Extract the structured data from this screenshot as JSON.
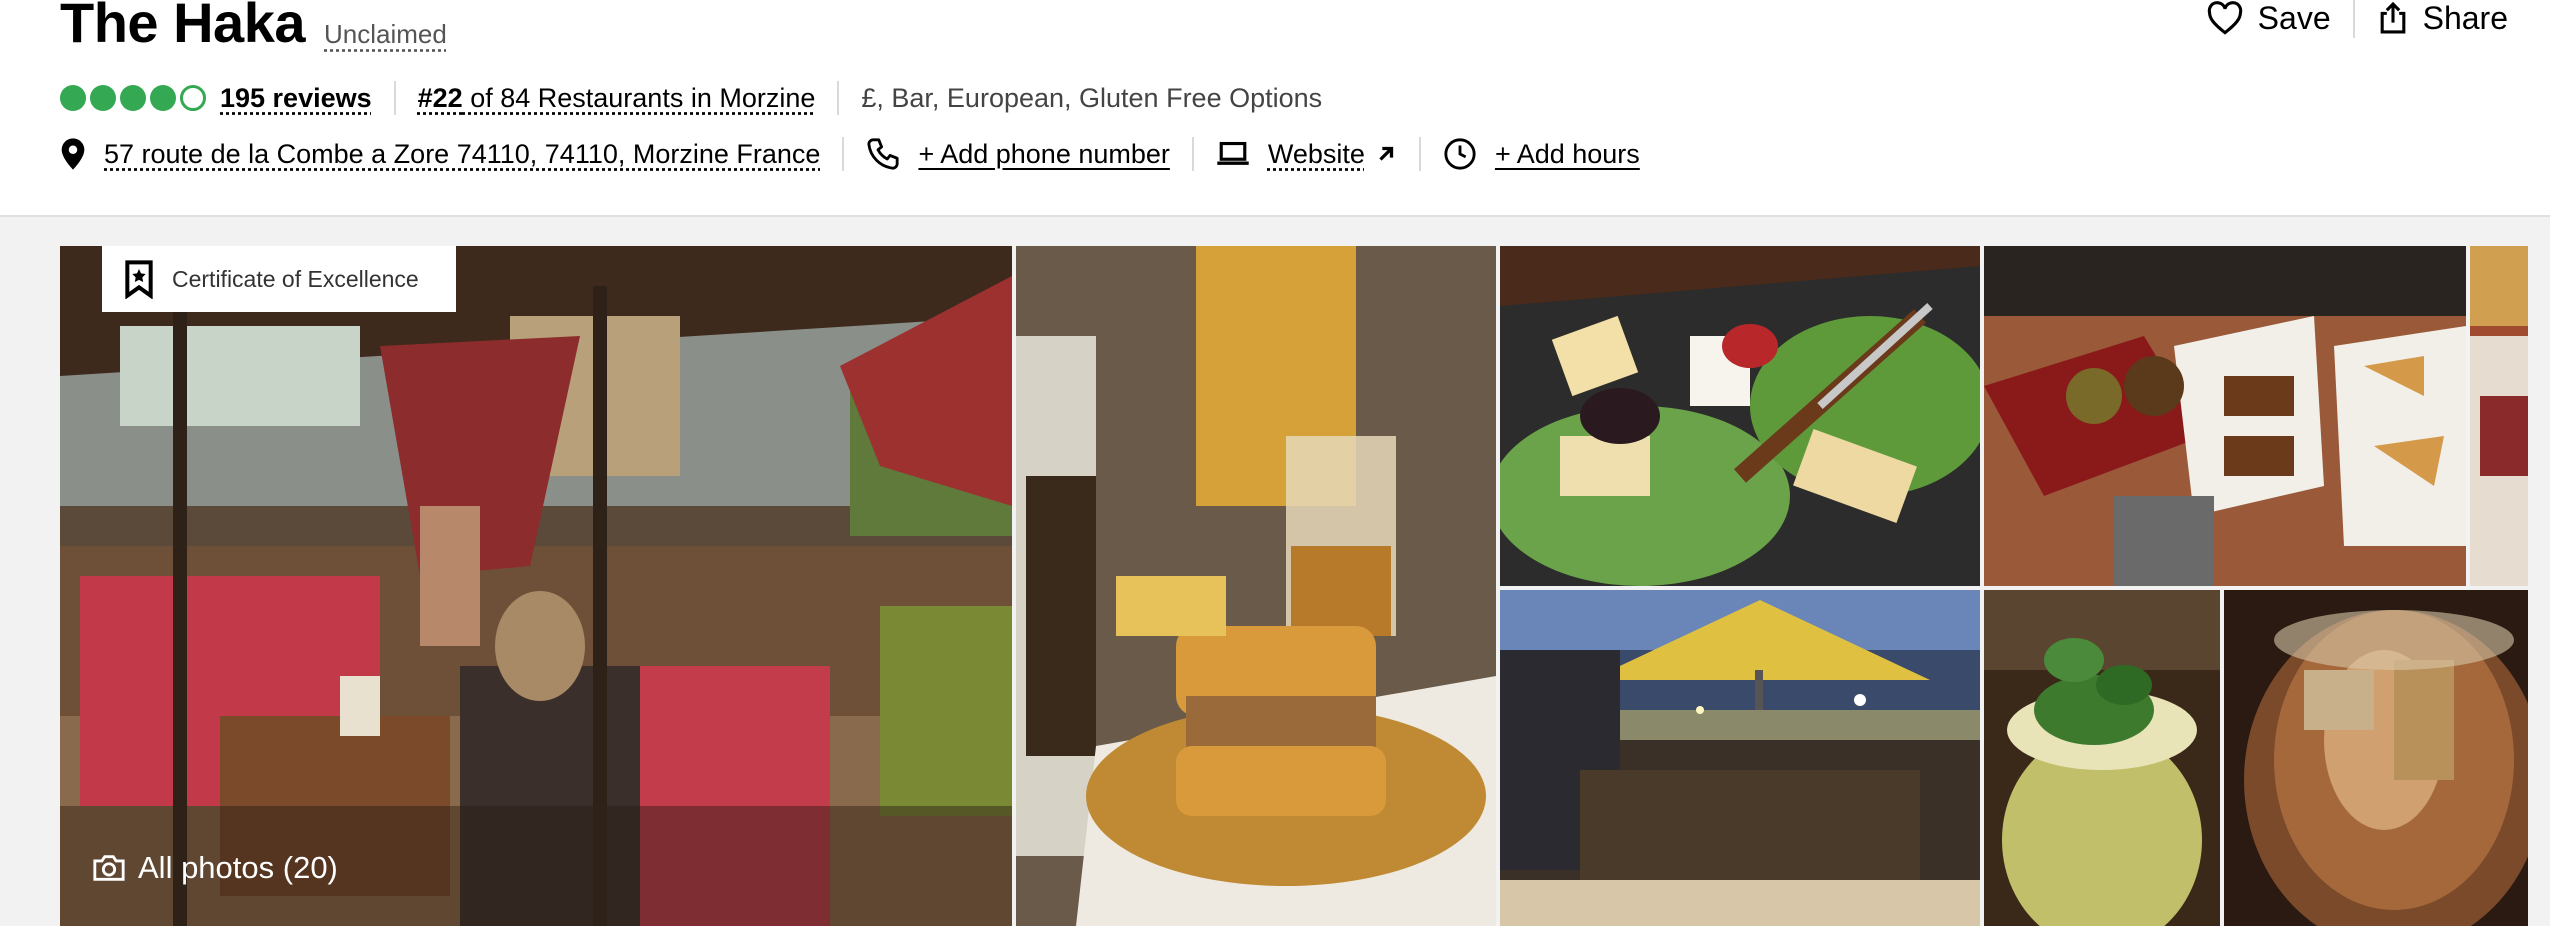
{
  "restaurant": {
    "name": "The Haka",
    "claim_status": "Unclaimed",
    "rating_bubbles": 4,
    "rating_max": 5,
    "reviews": "195 reviews",
    "rank_prefix": "#22",
    "rank_rest": " of 84 Restaurants in Morzine",
    "cuisines": "£, Bar, European, Gluten Free Options"
  },
  "actions": {
    "save_label": "Save",
    "share_label": "Share"
  },
  "contact": {
    "address": "57 route de la Combe a Zore 74110, 74110, Morzine France",
    "phone_label": "+ Add phone number",
    "website_label": "Website",
    "hours_label": "+ Add hours"
  },
  "gallery": {
    "badge": "Certificate of Excellence",
    "all_photos_label": "All photos (20)"
  },
  "colors": {
    "rating_green": "#34a853",
    "text": "#000000",
    "muted": "#555555"
  },
  "icons": [
    "heart-icon",
    "share-icon",
    "location-pin-icon",
    "phone-icon",
    "laptop-icon",
    "external-arrow-icon",
    "clock-icon",
    "bookmark-icon",
    "camera-icon"
  ]
}
